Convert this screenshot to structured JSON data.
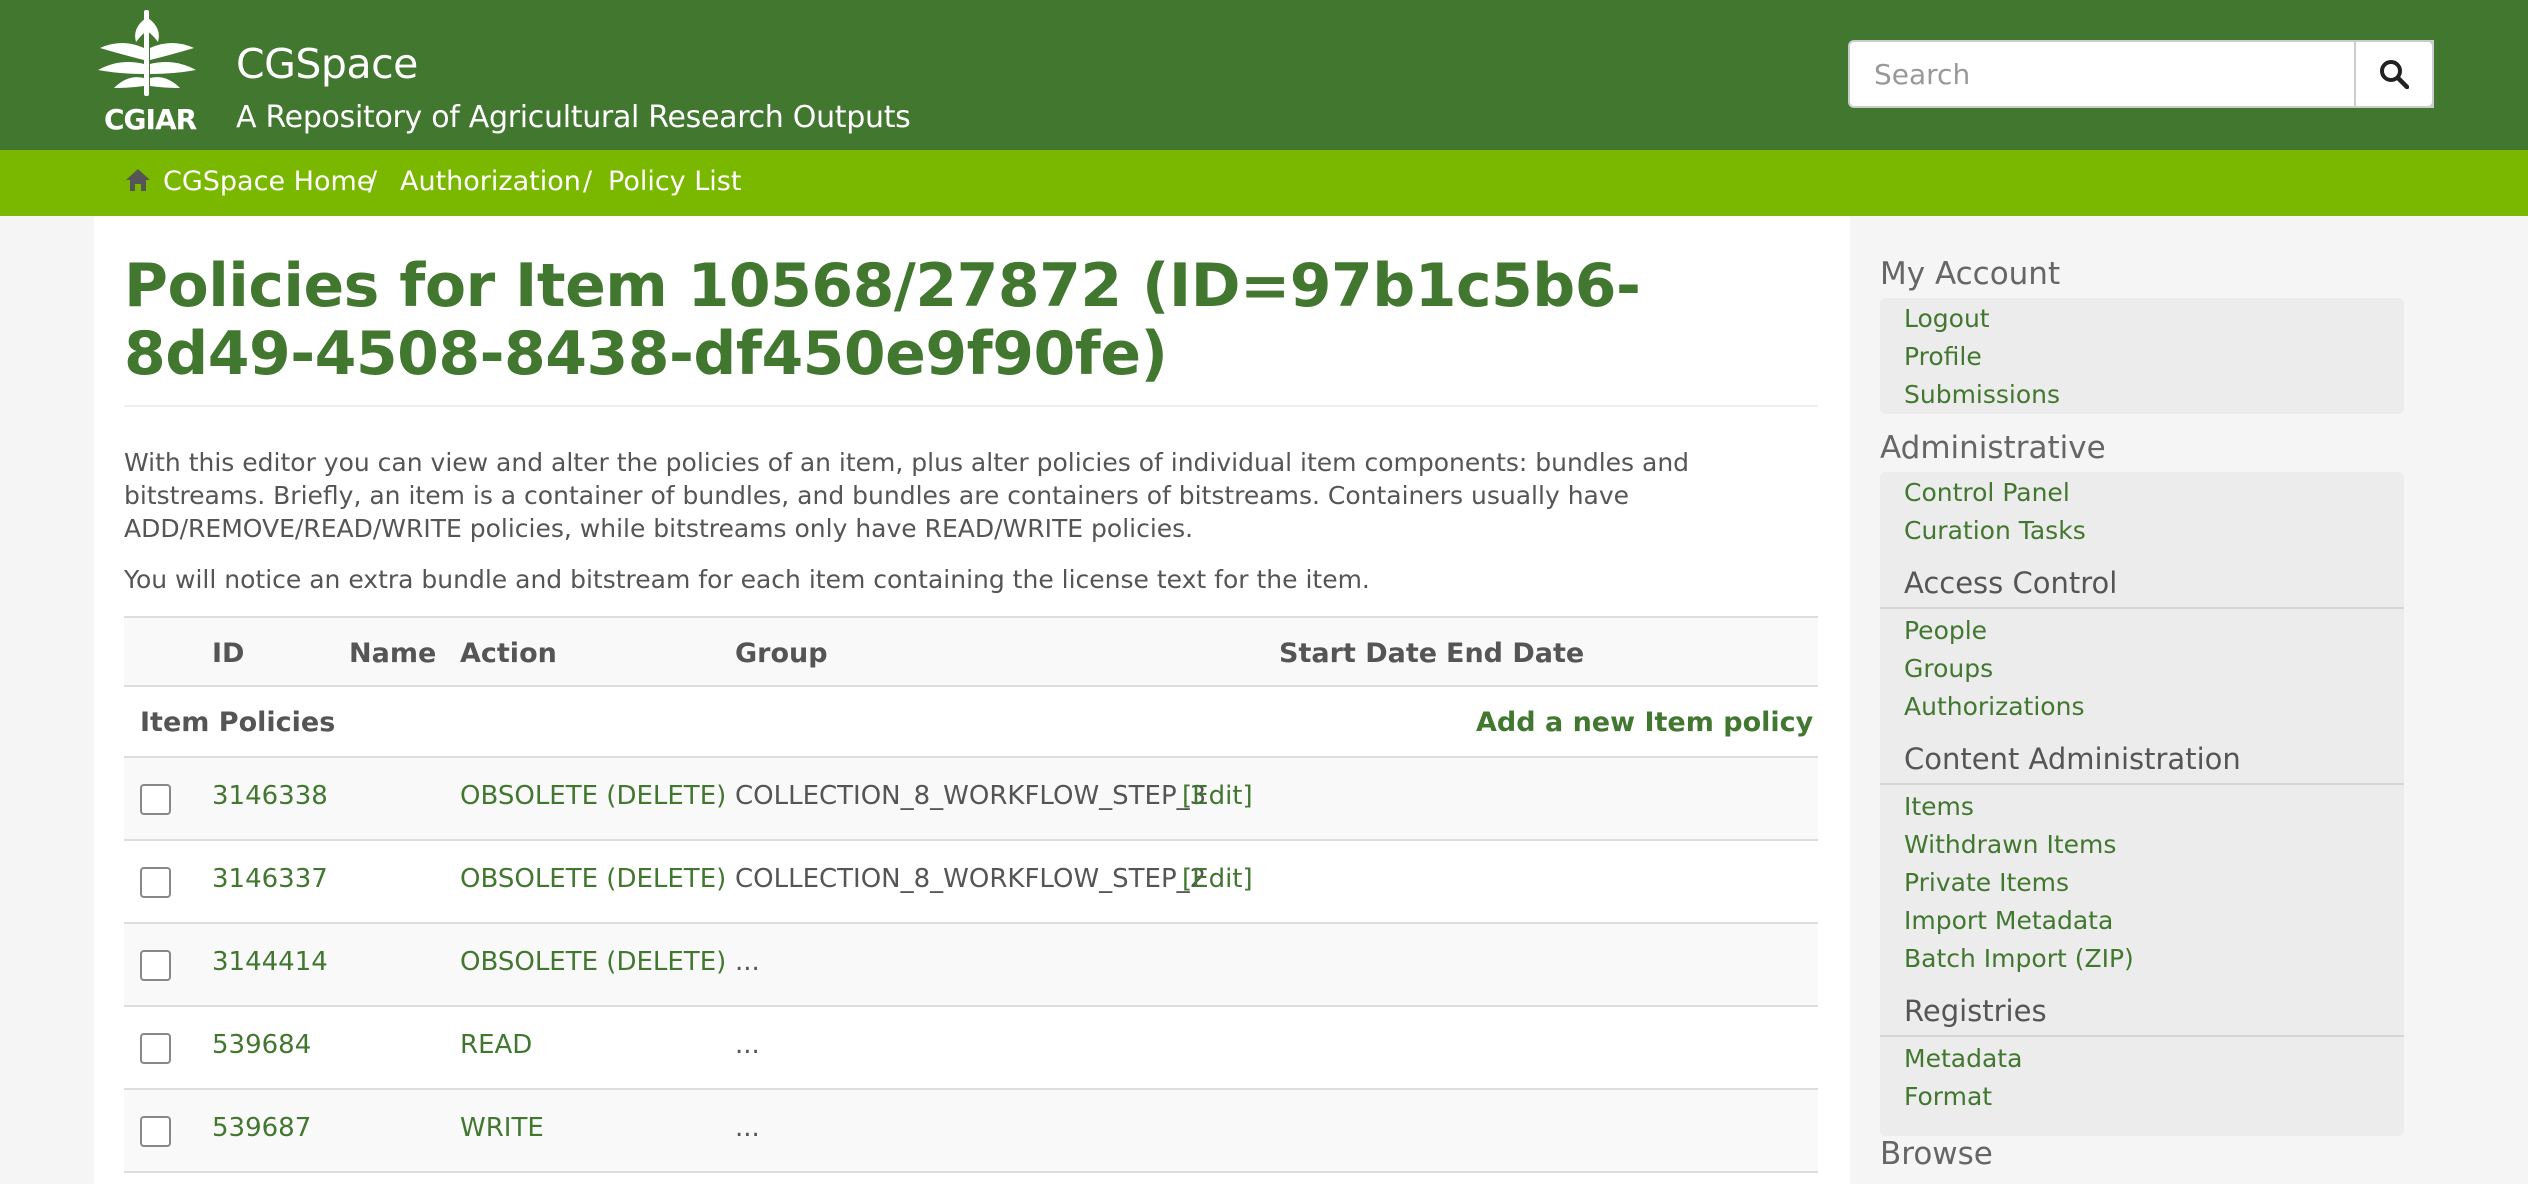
{
  "header": {
    "logo_text": "CGIAR",
    "site_title": "CGSpace",
    "site_subtitle": "A Repository of Agricultural Research Outputs",
    "search_placeholder": "Search"
  },
  "breadcrumb": {
    "items": [
      "CGSpace Home",
      "Authorization",
      "Policy List"
    ],
    "separator": "/"
  },
  "main": {
    "title": "Policies for Item 10568/27872 (ID=97b1c5b6-8d49-4508-8438-df450e9f90fe)",
    "intro": "With this editor you can view and alter the policies of an item, plus alter policies of individual item components: bundles and bitstreams. Briefly, an item is a container of bundles, and bundles are containers of bitstreams. Containers usually have ADD/REMOVE/READ/WRITE policies, while bitstreams only have READ/WRITE policies.",
    "intro2": "You will notice an extra bundle and bitstream for each item containing the license text for the item.",
    "table": {
      "headers": [
        "ID",
        "Name",
        "Action",
        "Group",
        "Start Date",
        "End Date"
      ],
      "section_label": "Item Policies",
      "add_link": "Add a new Item policy",
      "rows": [
        {
          "id": "3146338",
          "action": "OBSOLETE (DELETE)",
          "group": "COLLECTION_8_WORKFLOW_STEP_3",
          "edit": "[Edit]"
        },
        {
          "id": "3146337",
          "action": "OBSOLETE (DELETE)",
          "group": "COLLECTION_8_WORKFLOW_STEP_2",
          "edit": "[Edit]"
        },
        {
          "id": "3144414",
          "action": "OBSOLETE (DELETE)",
          "group": "...",
          "edit": ""
        },
        {
          "id": "539684",
          "action": "READ",
          "group": "...",
          "edit": ""
        },
        {
          "id": "539687",
          "action": "WRITE",
          "group": "...",
          "edit": ""
        }
      ]
    }
  },
  "sidebar": {
    "my_account": {
      "heading": "My Account",
      "links": [
        "Logout",
        "Profile",
        "Submissions"
      ]
    },
    "administrative": {
      "heading": "Administrative",
      "links": [
        "Control Panel",
        "Curation Tasks"
      ]
    },
    "access_control": {
      "heading": "Access Control",
      "links": [
        "People",
        "Groups",
        "Authorizations"
      ]
    },
    "content_admin": {
      "heading": "Content Administration",
      "links": [
        "Items",
        "Withdrawn Items",
        "Private Items",
        "Import Metadata",
        "Batch Import (ZIP)"
      ]
    },
    "registries": {
      "heading": "Registries",
      "links": [
        "Metadata",
        "Format"
      ]
    },
    "browse": {
      "heading": "Browse"
    }
  },
  "colors": {
    "header_green": "#427730",
    "breadcrumb_green": "#7ab800",
    "link_green": "#427730"
  }
}
